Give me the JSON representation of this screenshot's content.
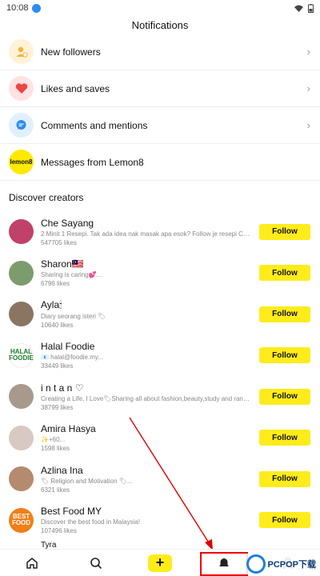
{
  "status": {
    "time": "10:08"
  },
  "header": {
    "title": "Notifications"
  },
  "notifications": [
    {
      "label": "New followers",
      "icon": "person-add-icon"
    },
    {
      "label": "Likes and saves",
      "icon": "heart-icon"
    },
    {
      "label": "Comments and mentions",
      "icon": "chat-bubble-icon"
    },
    {
      "label": "Messages from Lemon8",
      "icon": "lemon8-logo",
      "logo_text": "lemon8"
    }
  ],
  "discover": {
    "title": "Discover creators",
    "follow_label": "Follow",
    "creators": [
      {
        "name": "Che Sayang",
        "desc": "2 Minit 1 Resepi. Tak ada idea nak masak apa esok? Follow je resepi Che Sayang ...",
        "likes": "547705 likes",
        "avatar_color": "#c0416a"
      },
      {
        "name": "Sharon🇲🇾",
        "desc": "Sharing is caring💕...",
        "likes": "6796 likes",
        "avatar_color": "#7d9c6d"
      },
      {
        "name": "Ayla🕯",
        "desc": "Diary seorang isteri 🏷",
        "likes": "10640 likes",
        "avatar_color": "#8a7563"
      },
      {
        "name": "Halal Foodie",
        "desc": "📧 halal@foodie.my...",
        "likes": "33449 likes",
        "avatar_color": "#ffffff",
        "avatar_text": "HALAL FOODIE"
      },
      {
        "name": "i n t a n ♡",
        "desc": "Creating a Life, I Love🏷Sharing all about fashion,beauty,study and random stuff🏷",
        "likes": "38799 likes",
        "avatar_color": "#a79a8d"
      },
      {
        "name": "Amira Hasya",
        "desc": "✨+60...",
        "likes": "1598 likes",
        "avatar_color": "#d8c9c2"
      },
      {
        "name": "Azlina Ina",
        "desc": "🏷 Religion and Motivation 🏷...",
        "likes": "6321 likes",
        "avatar_color": "#b58a6e"
      },
      {
        "name": "Best Food MY",
        "desc": "Discover the best food in Malaysia!",
        "likes": "107496 likes",
        "avatar_color": "#f07f18",
        "avatar_text": "BEST FOOD"
      }
    ],
    "partial_next": "Tyra"
  },
  "bottom_nav": [
    {
      "name": "home-icon"
    },
    {
      "name": "search-icon"
    },
    {
      "name": "create-plus-button",
      "label": "+"
    },
    {
      "name": "notifications-icon"
    },
    {
      "name": "profile-icon"
    }
  ],
  "watermark": {
    "text": "PCPOP下载"
  },
  "colors": {
    "accent": "#ffec1a",
    "annotation": "#e00000"
  }
}
